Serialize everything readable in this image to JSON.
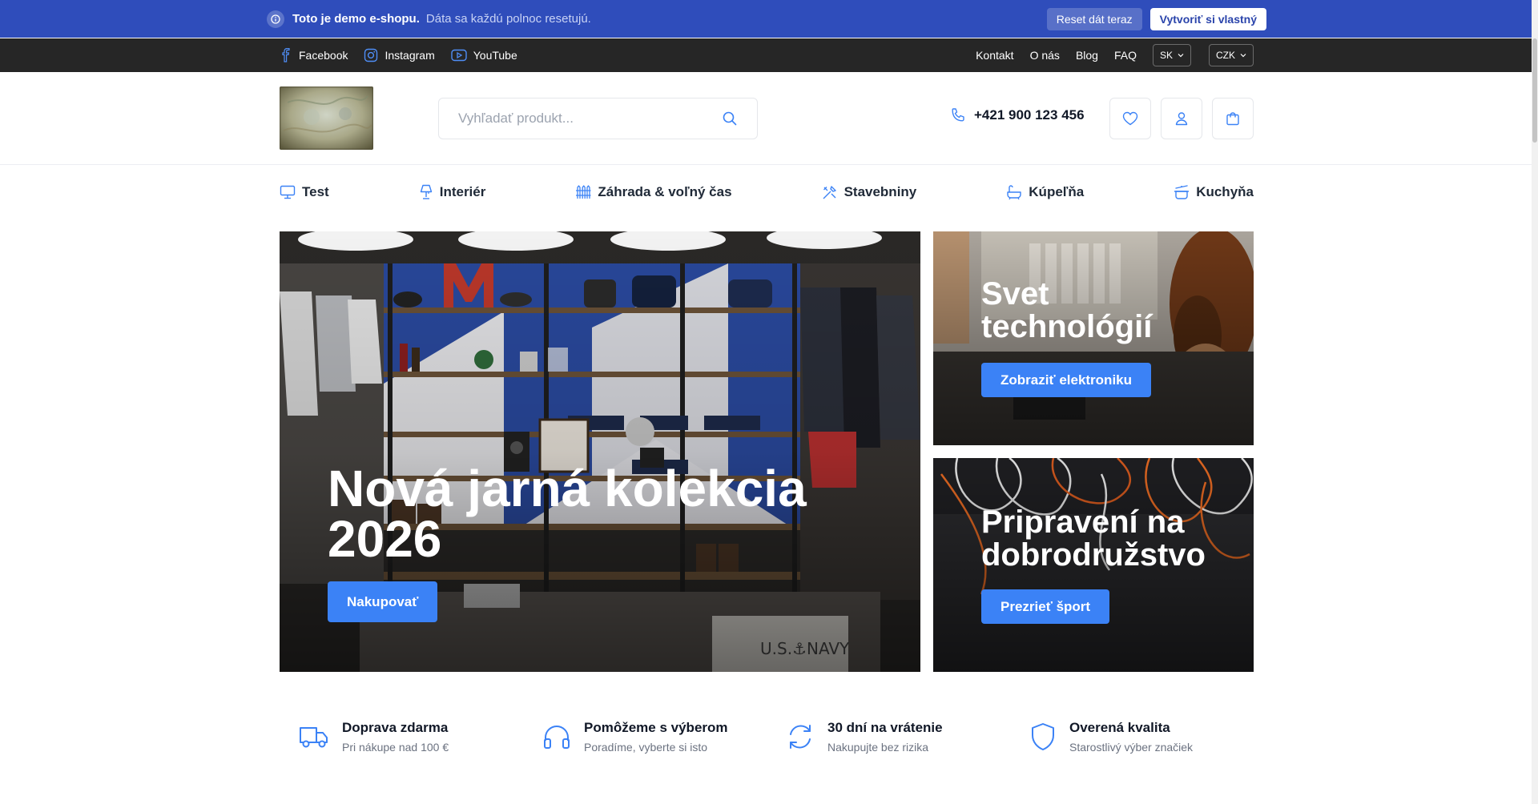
{
  "demo_bar": {
    "strong_text": "Toto je demo e-shopu.",
    "text": "Dáta sa každú polnoc resetujú.",
    "reset_label": "Reset dát teraz",
    "create_label": "Vytvoriť si vlastný"
  },
  "top_nav": {
    "socials": [
      {
        "label": "Facebook",
        "icon": "facebook-icon"
      },
      {
        "label": "Instagram",
        "icon": "instagram-icon"
      },
      {
        "label": "YouTube",
        "icon": "youtube-icon"
      }
    ],
    "links": [
      "Kontakt",
      "O nás",
      "Blog",
      "FAQ"
    ],
    "language": "SK",
    "currency": "CZK"
  },
  "header": {
    "search_placeholder": "Vyhľadať produkt...",
    "phone": "+421 900 123 456"
  },
  "categories": [
    {
      "label": "Test",
      "icon": "monitor-icon"
    },
    {
      "label": "Interiér",
      "icon": "lamp-icon"
    },
    {
      "label": "Záhrada & voľný čas",
      "icon": "fence-icon"
    },
    {
      "label": "Stavebniny",
      "icon": "tools-icon"
    },
    {
      "label": "Kúpeľňa",
      "icon": "bathtub-icon"
    },
    {
      "label": "Kuchyňa",
      "icon": "cooking-pot-icon"
    }
  ],
  "hero": {
    "main": {
      "title_line1": "Nová jarná kolekcia",
      "title_line2": "2026",
      "cta": "Nakupovať"
    },
    "side1": {
      "title_line1": "Svet",
      "title_line2": "technológií",
      "cta": "Zobraziť elektroniku"
    },
    "side2": {
      "title_line1": "Pripravení na",
      "title_line2": "dobrodružstvo",
      "cta": "Prezrieť šport"
    }
  },
  "features": [
    {
      "title": "Doprava zdarma",
      "subtitle": "Pri nákupe nad 100 €",
      "icon": "truck-icon"
    },
    {
      "title": "Pomôžeme s výberom",
      "subtitle": "Poradíme, vyberte si isto",
      "icon": "headphones-icon"
    },
    {
      "title": "30 dní na vrátenie",
      "subtitle": "Nakupujte bez rizika",
      "icon": "refresh-icon"
    },
    {
      "title": "Overená kvalita",
      "subtitle": "Starostlivý výber značiek",
      "icon": "shield-icon"
    }
  ],
  "colors": {
    "demo_bar": "#2f4dbb",
    "top_nav": "#262626",
    "accent": "#3b82f6"
  }
}
